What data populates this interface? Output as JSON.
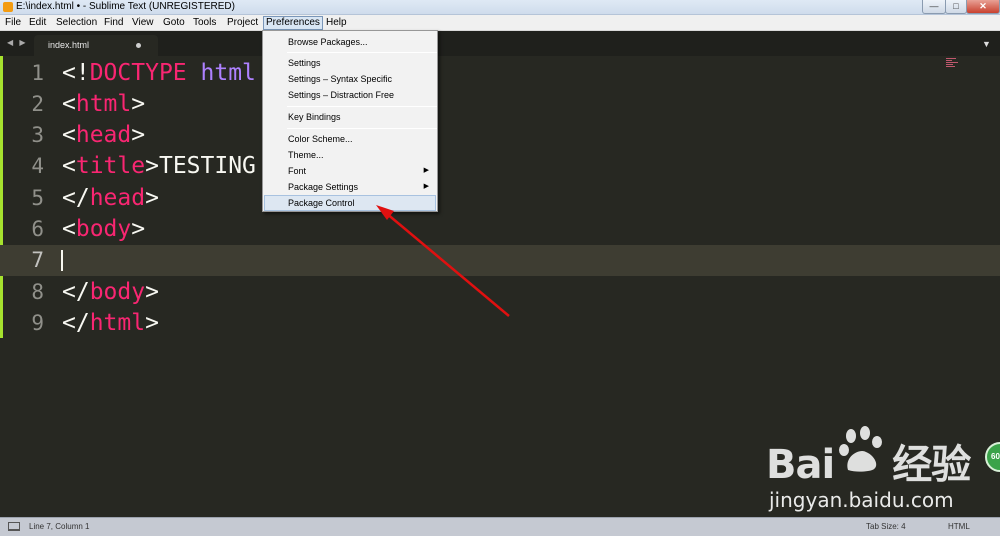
{
  "window": {
    "title": "E:\\index.html • - Sublime Text (UNREGISTERED)",
    "minimize": "—",
    "maximize": "□",
    "close": "✕"
  },
  "menubar": [
    "File",
    "Edit",
    "Selection",
    "Find",
    "View",
    "Goto",
    "Tools",
    "Project",
    "Preferences",
    "Help"
  ],
  "tabs": {
    "nav": "◀ ▶",
    "active_tab": "index.html",
    "dropdown": "▼"
  },
  "editor": {
    "line_numbers": [
      "1",
      "2",
      "3",
      "4",
      "5",
      "6",
      "7",
      "8",
      "9"
    ],
    "current_line": 7,
    "lines": [
      {
        "open": "<!",
        "tag": "DOCTYPE",
        "space": " ",
        "kw": "html",
        "rest": ""
      },
      {
        "open": "<",
        "tag": "html",
        "close": ">"
      },
      {
        "open": "<",
        "tag": "head",
        "close": ">"
      },
      {
        "open": "<",
        "tag": "title",
        "close": ">",
        "text": "TESTING"
      },
      {
        "open": "</",
        "tag": "head",
        "close": ">"
      },
      {
        "open": "<",
        "tag": "body",
        "close": ">"
      },
      {
        "open": "",
        "tag": "",
        "close": ""
      },
      {
        "open": "</",
        "tag": "body",
        "close": ">"
      },
      {
        "open": "</",
        "tag": "html",
        "close": ">"
      }
    ]
  },
  "preferences_menu": {
    "items": [
      "Browse Packages...",
      "Settings",
      "Settings – Syntax Specific",
      "Settings – Distraction Free",
      "Key Bindings",
      "Color Scheme...",
      "Theme...",
      "Font",
      "Package Settings",
      "Package Control"
    ],
    "submenu_arrow": "▶",
    "highlighted": "Package Control"
  },
  "statusbar": {
    "position": "Line 7, Column 1",
    "tab_size": "Tab Size: 4",
    "syntax": "HTML"
  },
  "watermark": {
    "brand_left": "Bai",
    "brand_right": "经验",
    "url": "jingyan.baidu.com",
    "badge": "60"
  },
  "colors": {
    "background": "#272822",
    "tag": "#f92672",
    "keyword": "#ae81ff",
    "text": "#f8f8f2",
    "arrow": "#e01010"
  }
}
